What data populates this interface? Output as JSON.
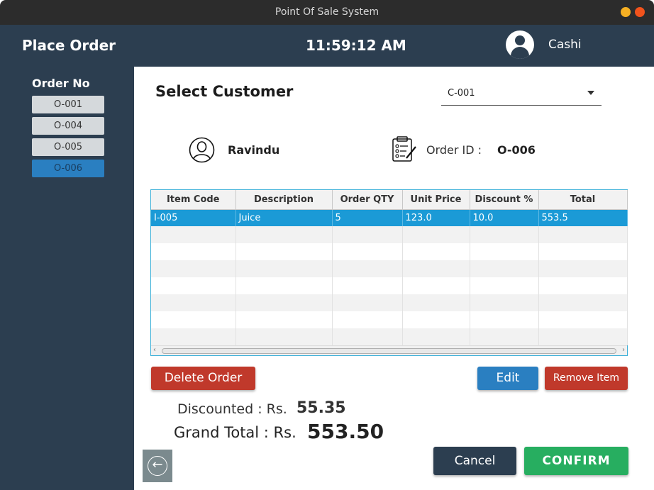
{
  "window": {
    "title": "Point Of Sale System"
  },
  "header": {
    "title": "Place Order",
    "clock": "11:59:12 AM",
    "user_name": "Cashi"
  },
  "sidebar": {
    "order_no_label": "Order No",
    "orders": [
      "O-001",
      "O-004",
      "O-005",
      "O-006"
    ],
    "active_order": "O-006"
  },
  "customer": {
    "heading": "Select Customer",
    "selected_id": "C-001",
    "name": "Ravindu",
    "order_id_label": "Order ID :",
    "order_id": "O-006"
  },
  "table": {
    "columns": [
      "Item Code",
      "Description",
      "Order QTY",
      "Unit Price",
      "Discount %",
      "Total"
    ],
    "rows": [
      [
        "I-005",
        "Juice",
        "5",
        "123.0",
        "10.0",
        "553.5"
      ]
    ]
  },
  "actions": {
    "delete_order": "Delete Order",
    "edit": "Edit",
    "remove_item": "Remove Item",
    "cancel": "Cancel",
    "confirm": "CONFIRM"
  },
  "summary": {
    "discounted_label": "Discounted : Rs.",
    "discounted_value": "55.35",
    "grand_total_label": "Grand Total : Rs.",
    "grand_total_value": "553.50"
  },
  "colors": {
    "primary_dark": "#2c3e50",
    "accent_blue": "#2a7fc1",
    "danger": "#c0392b",
    "success": "#27ae60",
    "row_selected": "#1b9ad6"
  },
  "icons": [
    "back-arrow-icon",
    "user-avatar-icon",
    "customer-icon",
    "order-clipboard-icon",
    "dropdown-arrow-icon"
  ]
}
